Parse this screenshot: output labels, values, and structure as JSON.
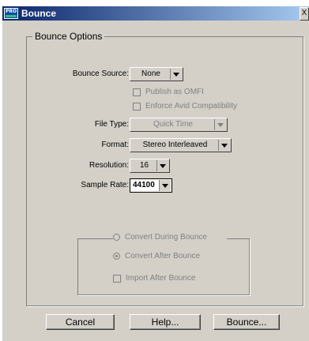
{
  "window": {
    "title": "Bounce",
    "close_glyph": "X"
  },
  "group": {
    "title": "Bounce Options"
  },
  "bounce_source": {
    "label": "Bounce Source:",
    "value": "None"
  },
  "publish_omfi": {
    "label": "Publish as OMFI",
    "checked": false
  },
  "enforce_avid": {
    "label": "Enforce Avid Compatibility",
    "checked": false
  },
  "file_type": {
    "label": "File Type:",
    "value": "Quick Time"
  },
  "format": {
    "label": "Format:",
    "value": "Stereo Interleaved"
  },
  "resolution": {
    "label": "Resolution:",
    "value": "16"
  },
  "sample_rate": {
    "label": "Sample Rate:",
    "value": "44100"
  },
  "convert_during": {
    "label": "Convert During Bounce",
    "selected": false
  },
  "convert_after": {
    "label": "Convert After Bounce",
    "selected": true
  },
  "import_after": {
    "label": "Import After Bounce",
    "checked": false
  },
  "buttons": {
    "cancel": "Cancel",
    "help": "Help...",
    "bounce": "Bounce..."
  },
  "icons": {
    "app": "pro-tools-icon",
    "dropdown": "chevron-down-icon",
    "close": "close-icon"
  },
  "colors": {
    "titlebar_start": "#0a246a",
    "titlebar_end": "#a6caf0",
    "face": "#d4d0c8"
  }
}
